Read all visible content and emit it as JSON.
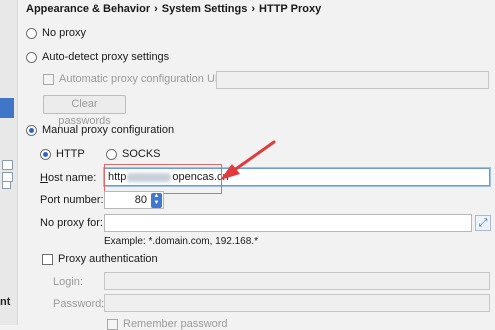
{
  "breadcrumb": [
    "Appearance & Behavior",
    "System Settings",
    "HTTP Proxy"
  ],
  "left_strip": {
    "partial_label": "nt"
  },
  "options": {
    "no_proxy": "No proxy",
    "auto_detect": "Auto-detect proxy settings",
    "auto_config_url": "Automatic proxy configuration URL:",
    "clear_passwords": "Clear passwords",
    "manual": "Manual proxy configuration",
    "http": "HTTP",
    "socks": "SOCKS"
  },
  "fields": {
    "host_label": "Host name:",
    "host_prefix": "http",
    "host_suffix": "opencas.cn",
    "port_label": "Port number:",
    "port_value": "80",
    "no_proxy_label": "No proxy for:",
    "no_proxy_value": "",
    "example": "Example: *.domain.com, 192.168.*"
  },
  "auth": {
    "label": "Proxy authentication",
    "login_label": "Login:",
    "password_label": "Password:",
    "remember": "Remember password"
  },
  "colors": {
    "accent": "#2f65ca",
    "annotation": "#e23a3a"
  }
}
